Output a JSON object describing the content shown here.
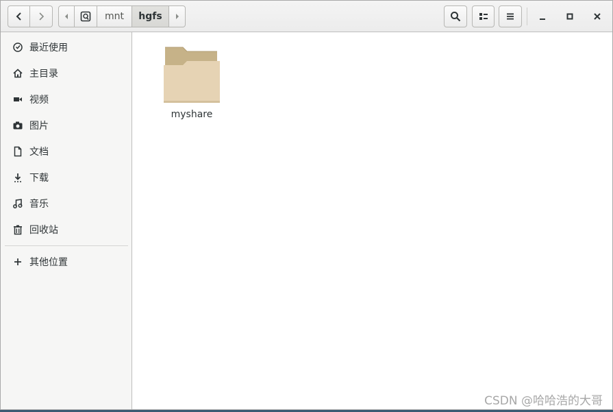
{
  "header": {
    "path": [
      {
        "label": "",
        "icon": "drive-icon"
      },
      {
        "label": "mnt"
      },
      {
        "label": "hgfs",
        "active": true
      }
    ]
  },
  "sidebar": {
    "items": [
      {
        "label": "最近使用",
        "icon": "clock-icon"
      },
      {
        "label": "主目录",
        "icon": "home-icon"
      },
      {
        "label": "视频",
        "icon": "video-icon"
      },
      {
        "label": "图片",
        "icon": "camera-icon"
      },
      {
        "label": "文档",
        "icon": "document-icon"
      },
      {
        "label": "下载",
        "icon": "download-icon"
      },
      {
        "label": "音乐",
        "icon": "music-icon"
      },
      {
        "label": "回收站",
        "icon": "trash-icon"
      },
      {
        "label": "其他位置",
        "icon": "plus-icon"
      }
    ]
  },
  "content": {
    "items": [
      {
        "label": "myshare",
        "type": "folder"
      }
    ]
  },
  "watermark": "CSDN @哈哈浩的大哥",
  "colors": {
    "folder_front": "#e6d3b4",
    "folder_back": "#c6b288",
    "sidebar_bg": "#f6f6f5"
  }
}
